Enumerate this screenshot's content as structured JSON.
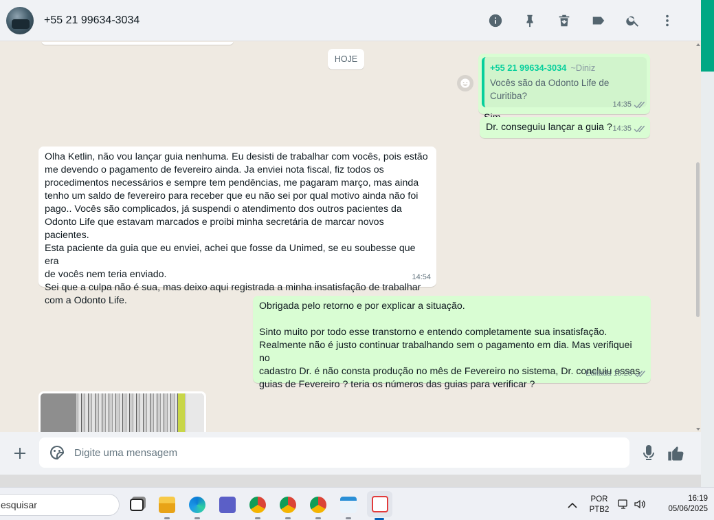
{
  "header": {
    "contact_name": "+55 21 99634-3034",
    "icons": [
      "info-icon",
      "pin-icon",
      "delete-icon",
      "label-icon",
      "search-icon",
      "menu-icon"
    ]
  },
  "chat": {
    "date_chip": "HOJE",
    "messages": [
      {
        "direction": "out",
        "quote_author": "+55 21 99634-3034",
        "quote_author_alias": "~Diniz",
        "quote_text": "Vocês são da Odonto Life de Curitiba?",
        "text": "Sim",
        "time": "14:35"
      },
      {
        "direction": "out",
        "text": "Dr. conseguiu lançar a guia ?",
        "time": "14:35"
      },
      {
        "direction": "in",
        "lines": [
          "Olha Ketlin, não vou lançar guia nenhuma. Eu desisti de trabalhar com vocês, pois estão",
          "me devendo o pagamento de fevereiro ainda. Ja enviei nota fiscal, fiz todos os",
          "procedimentos necessários e sempre tem pendências, me pagaram março, mas ainda",
          "tenho um saldo de fevereiro para receber que eu não sei por qual motivo ainda não foi",
          "pago.. Vocês são complicados, já suspendi o atendimento dos outros pacientes da",
          "Odonto Life que estavam marcados e proibi minha secretária de marcar novos pacientes.",
          "Esta paciente da guia que eu enviei, achei que fosse da Unimed, se eu soubesse que era",
          "de vocês nem teria enviado.",
          "Sei que a culpa não é sua, mas deixo aqui registrada a minha insatisfação de trabalhar",
          "com a Odonto Life."
        ],
        "time": "14:54"
      },
      {
        "direction": "out",
        "lines": [
          "Obrigada pelo retorno e por explicar a situação.",
          "",
          "Sinto muito por todo esse transtorno e entendo completamente sua insatisfação.",
          "Realmente não é justo continuar trabalhando sem o pagamento em dia. Mas verifiquei no",
          "cadastro Dr. é não consta produção no mês de Fevereiro no sistema, Dr. concluiu essas",
          "guias de Fevereiro ? teria os números das guias para verificar ?"
        ],
        "edited_label": "Editada",
        "time": "15:28"
      }
    ]
  },
  "compose": {
    "placeholder": "Digite uma mensagem",
    "value": ""
  },
  "taskbar": {
    "search_text": "esquisar",
    "apps": [
      "task-view",
      "file-explorer",
      "edge",
      "teams",
      "chrome-profile-1",
      "chrome-profile-2",
      "chrome-profile-3",
      "notepad",
      "snipping-tool"
    ],
    "lang_line1": "POR",
    "lang_line2": "PTB2",
    "time": "16:19",
    "date": "05/06/2025"
  },
  "colors": {
    "accent": "#00a884",
    "outgoing_bubble": "#d9fdd3",
    "incoming_bubble": "#ffffff",
    "chat_bg": "#efeae2",
    "quote_author": "#06cf9c"
  }
}
